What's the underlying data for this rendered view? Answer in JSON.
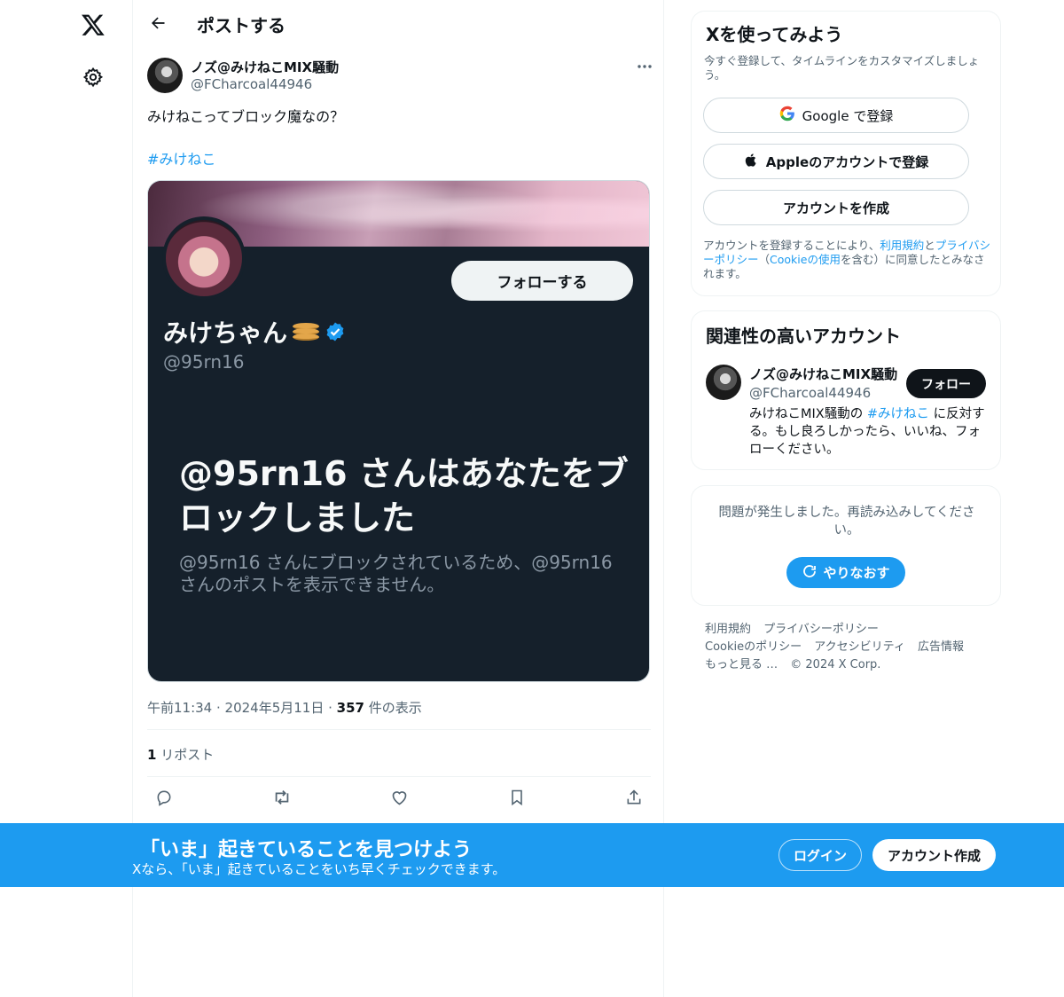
{
  "header": {
    "title": "ポストする"
  },
  "tweet": {
    "author_name": "ノズ@みけねこMIX騒動",
    "author_handle": "@FCharcoal44946",
    "text": "みけねこってブロック魔なの？",
    "hashtag": "#みけねこ",
    "time": "午前11:34",
    "date": "2024年5月11日",
    "views_count": "357",
    "views_label": "件の表示",
    "reposts_count": "1",
    "reposts_label": "リポスト"
  },
  "embedded_image": {
    "follow_label": "フォローする",
    "name": "みけちゃん",
    "handle": "@95rn16",
    "blocked_title": "@95rn16 さんはあなたをブロックしました",
    "blocked_desc": "@95rn16 さんにブロックされているため、@95rn16 さんのポストを表示できません。"
  },
  "signup": {
    "title": "Xを使ってみよう",
    "subtitle": "今すぐ登録して、タイムラインをカスタマイズしましょう。",
    "google_label": "Google で登録",
    "apple_label": "Appleのアカウントで登録",
    "create_label": "アカウントを作成",
    "legal_pre": "アカウントを登録することにより、",
    "legal_terms": "利用規約",
    "legal_and": "と",
    "legal_privacy": "プライバシーポリシー",
    "legal_paren_open": "（",
    "legal_cookie": "Cookieの使用",
    "legal_post": "を含む）に同意したとみなされます。"
  },
  "relevant": {
    "title": "関連性の高いアカウント",
    "name": "ノズ@みけねこMIX騒動",
    "handle": "@FCharcoal44946",
    "follow_label": "フォロー",
    "bio_pre": "みけねこMIX騒動の ",
    "bio_tag": "#みけねこ",
    "bio_post": " に反対する。もし良ろしかったら、いいね、フォローください。"
  },
  "error": {
    "message": "問題が発生しました。再読み込みしてください。",
    "retry_label": "やりなおす"
  },
  "footer": {
    "links": [
      "利用規約",
      "プライバシーポリシー",
      "Cookieのポリシー",
      "アクセシビリティ",
      "広告情報",
      "もっと見る …",
      "© 2024 X Corp."
    ]
  },
  "bottom_bar": {
    "title": "「いま」起きていることを見つけよう",
    "subtitle": "Xなら、「いま」起きていることをいち早くチェックできます。",
    "login_label": "ログイン",
    "signup_label": "アカウント作成"
  },
  "colors": {
    "accent": "#1d9bf0",
    "text": "#0f1419",
    "muted": "#536471",
    "embed_bg": "#15202b"
  },
  "icons": [
    "x-logo-icon",
    "gear-icon",
    "back-arrow-icon",
    "more-icon",
    "verified-icon",
    "google-icon",
    "apple-icon",
    "reply-icon",
    "repost-icon",
    "like-icon",
    "bookmark-icon",
    "share-icon",
    "refresh-icon"
  ]
}
